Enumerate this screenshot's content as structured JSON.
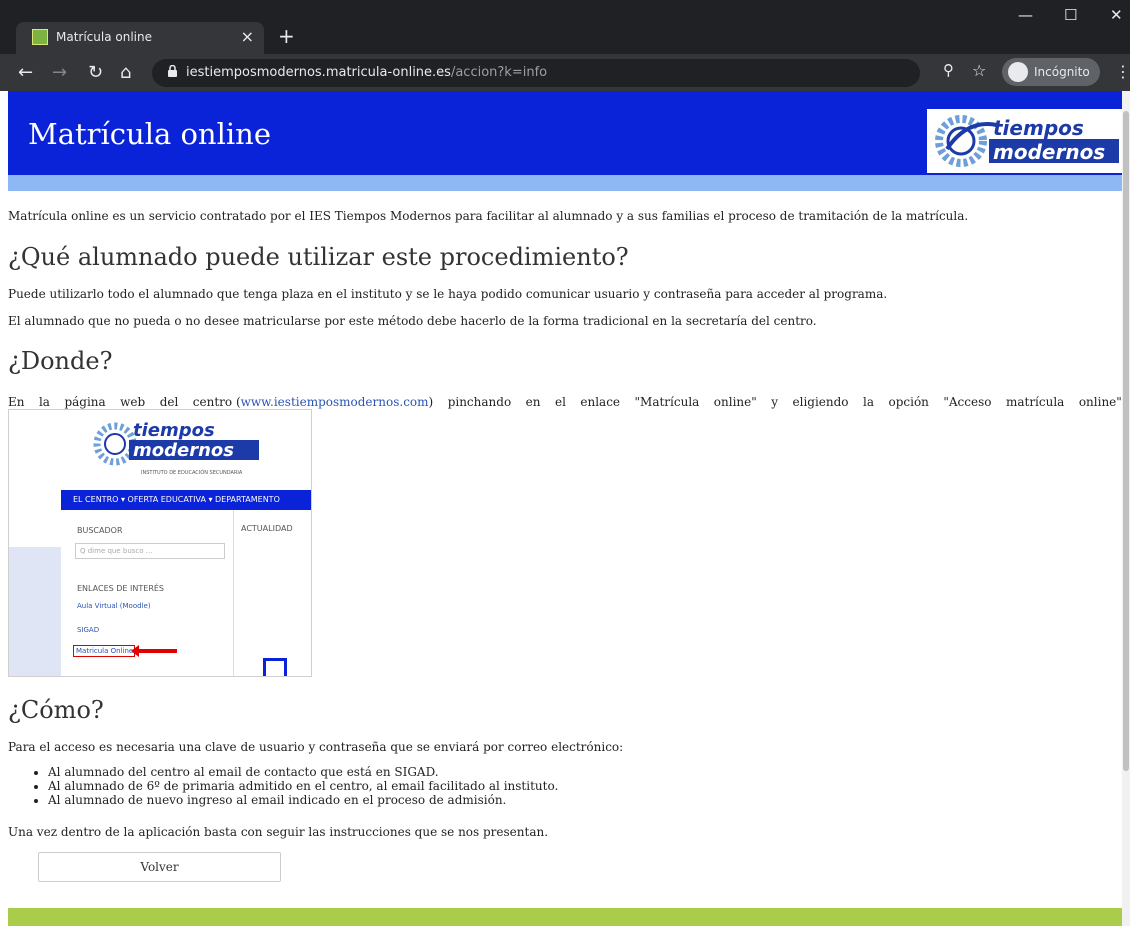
{
  "browser": {
    "tab_title": "Matrícula online",
    "tab_close": "×",
    "new_tab": "+",
    "url_host": "iestiemposmodernos.matricula-online.es",
    "url_path": "/accion?k=info",
    "incognito_label": "Incógnito",
    "icons": [
      "back-arrow",
      "forward-arrow",
      "reload",
      "home",
      "lock",
      "zoom",
      "star",
      "incognito",
      "menu"
    ]
  },
  "header": {
    "title": "Matrícula online",
    "logo_text_top": "tiempos",
    "logo_text_bottom": "modernos",
    "colors": {
      "primary": "#0a22d8",
      "band": "#8db8f4",
      "footer": "#a9cc4a"
    }
  },
  "content": {
    "intro": "Matrícula online es un servicio contratado por el IES Tiempos Modernos para facilitar al alumnado y a sus familias el proceso de tramitación de la matrícula.",
    "section1": {
      "heading": "¿Qué alumnado puede utilizar este procedimiento?",
      "p1": "Puede utilizarlo todo el alumnado que tenga plaza en el instituto y se le haya podido comunicar usuario y contraseña para acceder al programa.",
      "p2": "El alumnado que no pueda o no desee matricularse por este método debe hacerlo de la forma tradicional en la secretaría del centro."
    },
    "section2": {
      "heading": "¿Donde?",
      "words": [
        "En",
        "la",
        "página",
        "web",
        "del",
        "centro",
        "(",
        "y",
        "eligiendo",
        "la",
        "opción",
        "\"Acceso",
        "matrícula",
        "online\""
      ],
      "text_before": "En la página web del centro (",
      "link": "www.iestiemposmodernos.com",
      "text_after_link": ")",
      "rest": [
        "pinchando",
        "en",
        "el",
        "enlace",
        "\"Matrícula",
        "online\"",
        "y",
        "eligiendo",
        "la",
        "opción",
        "\"Acceso",
        "matrícula",
        "online\""
      ],
      "screenshot": {
        "logo_top": "tiempos",
        "logo_bottom": "modernos",
        "logo_sub": "INSTITUTO DE EDUCACIÓN SECUNDARIA",
        "nav": "EL CENTRO ▾   OFERTA EDUCATIVA ▾   DEPARTAMENTO",
        "buscador": "BUSCADOR",
        "actualidad": "ACTUALIDAD",
        "search_placeholder": "Q dime que busco ...",
        "enlaces": "ENLACES DE INTERÉS",
        "link1": "Aula Virtual (Moodle)",
        "link2": "SIGAD",
        "link3": "Matricula Online"
      }
    },
    "section3": {
      "heading": "¿Cómo?",
      "p1": "Para el acceso es necesaria una clave de usuario y contraseña que se enviará por correo electrónico:",
      "bullets": [
        "Al alumnado del centro al email de contacto que está en SIGAD.",
        "Al alumnado de 6º de primaria admitido en el centro, al email facilitado al instituto.",
        "Al alumnado de nuevo ingreso al email indicado en el proceso de admisión."
      ],
      "p2": "Una vez dentro de la aplicación basta con seguir las instrucciones que se nos presentan."
    },
    "volver_label": "Volver"
  }
}
